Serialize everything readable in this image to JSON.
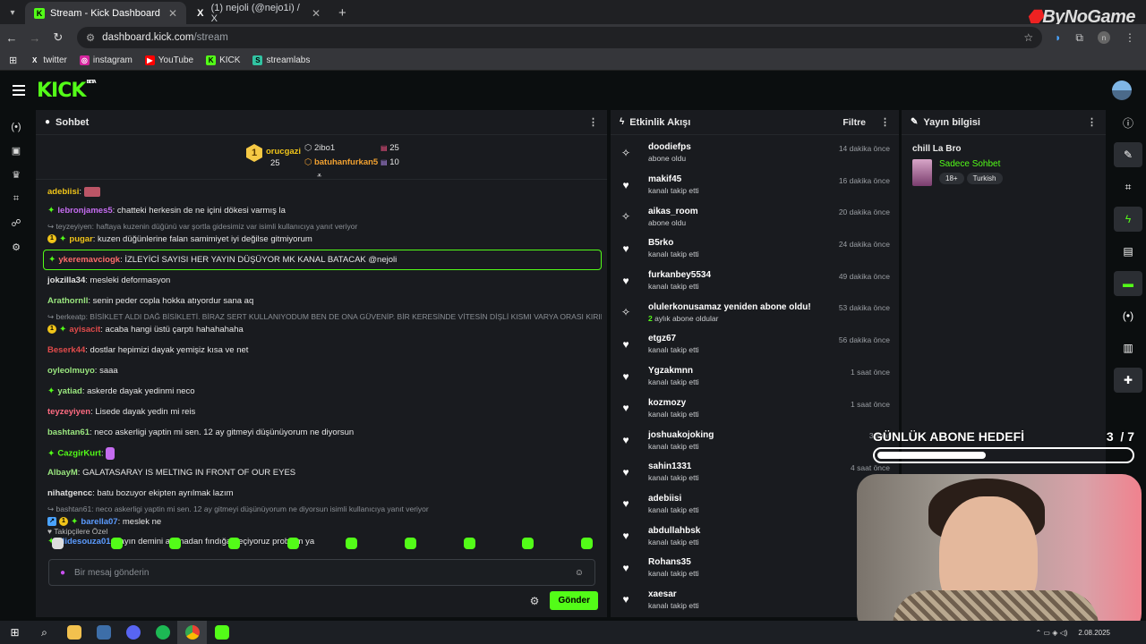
{
  "browser": {
    "tabs": [
      {
        "title": "Stream - Kick Dashboard",
        "active": true,
        "favicon": "kick-icon"
      },
      {
        "title": "(1) nejoli (@nejo1i) / X",
        "active": false,
        "favicon": "x-icon"
      }
    ],
    "url_host": "dashboard.kick.com",
    "url_path": "/stream",
    "bookmarks": [
      "twitter",
      "instagram",
      "YouTube",
      "KICK",
      "streamlabs"
    ],
    "profile_initial": "n"
  },
  "watermark": "ByNoGame",
  "kick": {
    "logo": "KICK",
    "beta": "BETA"
  },
  "chat": {
    "title": "Sohbet",
    "leaderboard": {
      "rank": "1",
      "first_name": "orucgazi",
      "first_count": "25",
      "second_name": "2ibo1",
      "second_count": "25",
      "third_name": "batuhanfurkan5",
      "third_count": "10"
    },
    "messages": [
      {
        "user": "adebiisi",
        "text": ":",
        "color": "#f0c419"
      },
      {
        "user": "lebronjames5",
        "text": ": chatteki herkesin de ne içini dökesi varmış la",
        "color": "#c56cf0"
      },
      {
        "reply": "teyzeyiyen: haftaya kuzenin düğünü var şortla gidesimiz var isimli kullanıcıya yanıt veriyor"
      },
      {
        "user": "pugar",
        "text": ": kuzen düğünlerine falan samimiyet iyi değilse gitmiyorum",
        "color": "#f0c419"
      },
      {
        "user": "ykeremavciogk",
        "text": ": İZLEYİCİ SAYISI HER YAYIN DÜŞÜYOR MK KANAL BATACAK @nejoli",
        "color": "#ff6b6b"
      },
      {
        "user": "jokzilla34",
        "text": ": mesleki deformasyon",
        "color": "#e0e0e0"
      },
      {
        "user": "Arathornll",
        "text": ": senin peder copla hokka atıyordur sana aq",
        "color": "#9ae67f"
      },
      {
        "reply": "berkeatp: BİSİKLET ALDI DAĞ BİSİKLETİ. BİRAZ SERT KULLANIYODUM BEN DE ONA GÜVENİP. BİR KERESİNDE VİTESİN DİŞLİ KISMI VARYA ORASI KIRILDI ..."
      },
      {
        "user": "ayisacit",
        "text": ": acaba hangi üstü çarptı hahahahaha",
        "color": "#e14b4b"
      },
      {
        "user": "Beserk44",
        "text": ": dostlar hepimizi dayak yemişiz kısa ve net",
        "color": "#e14b4b"
      },
      {
        "user": "oyleolmuyo",
        "text": ": saaa",
        "color": "#9ae67f"
      },
      {
        "user": "yatiad",
        "text": ": askerde dayak yedinmi neco",
        "color": "#9ae67f"
      },
      {
        "user": "teyzeyiyen",
        "text": ": Lisede dayak yedin mi reis",
        "color": "#ff6b81"
      },
      {
        "user": "bashtan61",
        "text": ": neco askerligi yaptin mi sen. 12 ay gitmeyi düşünüyorum ne diyorsun",
        "color": "#9ae67f"
      },
      {
        "user": "CazgirKurt",
        "text": ":",
        "color": "#53fc18"
      },
      {
        "user": "AlbayM",
        "text": ": GALATASARAY IS MELTING IN FRONT OF OUR EYES",
        "color": "#9ae67f"
      },
      {
        "user": "nihatgencc",
        "text": ": batu bozuyor ekipten ayrılmak lazım",
        "color": "#e0e0e0"
      },
      {
        "reply": "bashtan61: neco askerligi yaptin mi sen. 12 ay gitmeyi düşünüyorum ne diyorsun isimli kullanıcıya yanıt veriyor"
      },
      {
        "user": "barella07",
        "text": ": meslek ne",
        "color": "#5b9bff"
      },
      {
        "user": "alidesouza01",
        "text": ": yayın demini alamadan fındığa geçiyoruz problem ya",
        "color": "#5b9bff"
      }
    ],
    "followers_only": "Takipçilere Özel",
    "input_placeholder": "Bir mesaj gönderin",
    "send_label": "Gönder"
  },
  "activity": {
    "title": "Etkinlik Akışı",
    "filter_label": "Filtre",
    "events": [
      {
        "name": "doodiefps",
        "detail": "abone oldu",
        "time": "14 dakika önce",
        "icon": "sparkle-icon"
      },
      {
        "name": "makif45",
        "detail": "kanalı takip etti",
        "time": "16 dakika önce",
        "icon": "heart-icon"
      },
      {
        "name": "aikas_room",
        "detail": "abone oldu",
        "time": "20 dakika önce",
        "icon": "sparkle-icon"
      },
      {
        "name": "B5rko",
        "detail": "kanalı takip etti",
        "time": "24 dakika önce",
        "icon": "heart-icon"
      },
      {
        "name": "furkanbey5534",
        "detail": "kanalı takip etti",
        "time": "49 dakika önce",
        "icon": "heart-icon"
      },
      {
        "name": "olulerkonusamaz yeniden abone oldu!",
        "detail": "aylık abone oldular",
        "months": "2",
        "time": "53 dakika önce",
        "icon": "sparkle-icon"
      },
      {
        "name": "etgz67",
        "detail": "kanalı takip etti",
        "time": "56 dakika önce",
        "icon": "heart-icon"
      },
      {
        "name": "Ygzakmnn",
        "detail": "kanalı takip etti",
        "time": "1 saat önce",
        "icon": "heart-icon"
      },
      {
        "name": "kozmozy",
        "detail": "kanalı takip etti",
        "time": "1 saat önce",
        "icon": "heart-icon"
      },
      {
        "name": "joshuakojoking",
        "detail": "kanalı takip etti",
        "time": "3 saat",
        "icon": "heart-icon"
      },
      {
        "name": "sahin1331",
        "detail": "kanalı takip etti",
        "time": "4 saat önce",
        "icon": "heart-icon"
      },
      {
        "name": "adebiisi",
        "detail": "kanalı takip etti",
        "time": "5",
        "icon": "heart-icon"
      },
      {
        "name": "abdullahbsk",
        "detail": "kanalı takip etti",
        "time": "9",
        "icon": "heart-icon"
      },
      {
        "name": "Rohans35",
        "detail": "kanalı takip etti",
        "time": "9",
        "icon": "heart-icon"
      },
      {
        "name": "xaesar",
        "detail": "kanalı takip etti",
        "time": "12",
        "icon": "heart-icon"
      }
    ]
  },
  "stream_info": {
    "title": "Yayın bilgisi",
    "stream_title": "chill La Bro",
    "category": "Sadece Sohbet",
    "tags": [
      "18+",
      "Turkish"
    ]
  },
  "overlay": {
    "goal_label": "GÜNLÜK ABONE HEDEFİ",
    "goal_count": "3",
    "goal_total": "/ 7",
    "goal_progress": 0.43
  },
  "taskbar": {
    "date": "2.08.2025"
  }
}
